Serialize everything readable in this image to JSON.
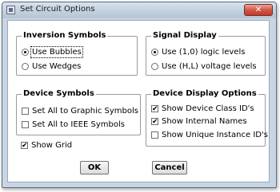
{
  "window": {
    "title": "Set Circuit Options",
    "close_symbol": "✕"
  },
  "inversion_symbols": {
    "title": "Inversion Symbols",
    "options": [
      {
        "label": "Use Bubbles",
        "selected": true
      },
      {
        "label": "Use Wedges",
        "selected": false
      }
    ]
  },
  "signal_display": {
    "title": "Signal Display",
    "options": [
      {
        "label": "Use (1,0) logic levels",
        "selected": true
      },
      {
        "label": "Use (H,L) voltage levels",
        "selected": false
      }
    ]
  },
  "device_symbols": {
    "title": "Device Symbols",
    "options": [
      {
        "label": "Set All to Graphic Symbols",
        "checked": false
      },
      {
        "label": "Set All to IEEE Symbols",
        "checked": false
      }
    ]
  },
  "device_display": {
    "title": "Device Display Options",
    "options": [
      {
        "label": "Show Device Class ID's",
        "checked": true
      },
      {
        "label": "Show Internal Names",
        "checked": true
      },
      {
        "label": "Show Unique Instance ID's",
        "checked": false
      }
    ]
  },
  "show_grid": {
    "label": "Show Grid",
    "checked": true
  },
  "buttons": {
    "ok": "OK",
    "cancel": "Cancel"
  },
  "check_mark": "✔"
}
